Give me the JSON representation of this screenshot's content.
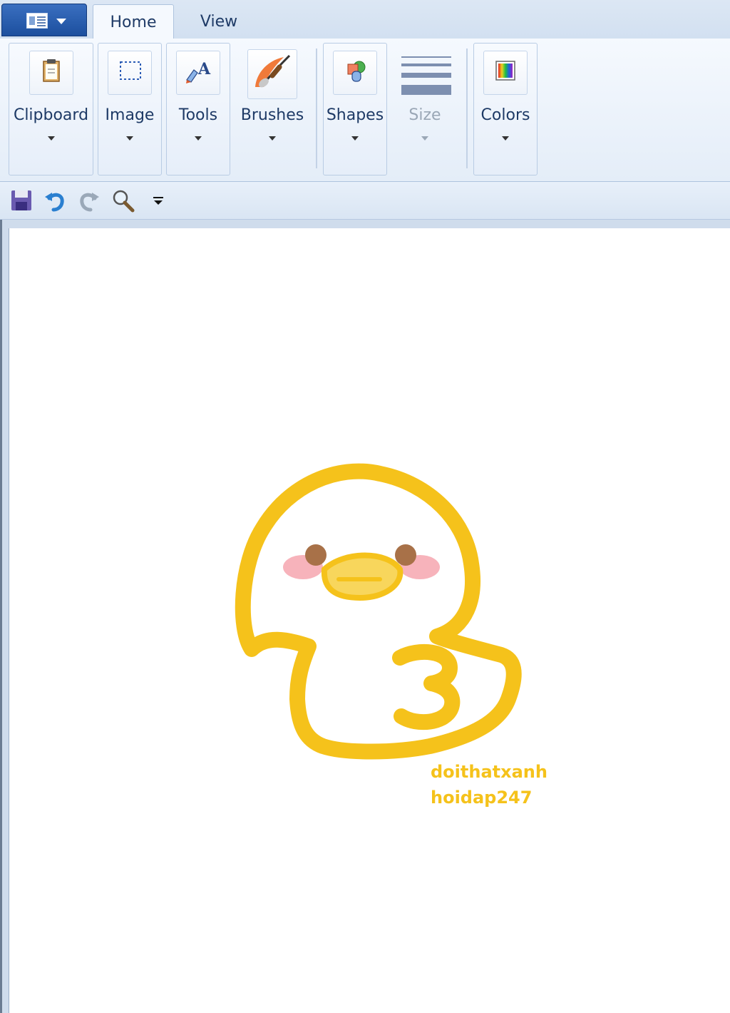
{
  "tabs": [
    {
      "label": "Home",
      "active": true
    },
    {
      "label": "View",
      "active": false
    }
  ],
  "ribbon": {
    "groups": [
      {
        "label": "Clipboard",
        "icon": "clipboard-icon"
      },
      {
        "label": "Image",
        "icon": "select-icon"
      },
      {
        "label": "Tools",
        "icon": "tools-icon"
      },
      {
        "label": "Brushes",
        "icon": "brush-icon"
      },
      {
        "label": "Shapes",
        "icon": "shapes-icon"
      },
      {
        "label": "Size",
        "icon": "size-icon",
        "disabled": true
      },
      {
        "label": "Colors",
        "icon": "colors-icon"
      }
    ]
  },
  "quick_access": [
    {
      "icon": "save-icon"
    },
    {
      "icon": "undo-icon"
    },
    {
      "icon": "redo-icon"
    },
    {
      "icon": "zoom-icon"
    },
    {
      "icon": "customize-dropdown-icon"
    }
  ],
  "canvas": {
    "watermark_lines": [
      "doithatxanh",
      "hoidap247"
    ],
    "drawing_color": "#f5c21b",
    "accent_color": "#1c4f9e"
  }
}
